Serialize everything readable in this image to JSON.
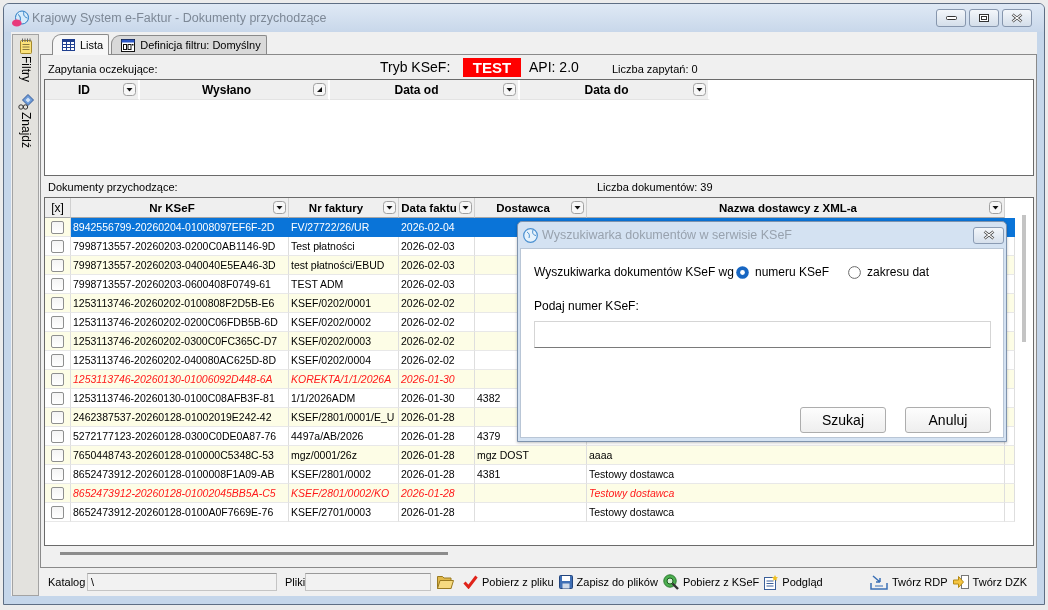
{
  "window": {
    "title": "Krajowy System e-Faktur - Dokumenty przychodzące",
    "active": false
  },
  "sidebar": {
    "items": [
      {
        "label": "Filtry"
      },
      {
        "label": "Znajdź"
      }
    ]
  },
  "tabs": [
    {
      "label": "Lista",
      "selected": true
    },
    {
      "label": "Definicja filtru: Domyślny",
      "selected": false
    }
  ],
  "pending_requests": {
    "label": "Zapytania oczekujące:",
    "mode_label": "Tryb KSeF:",
    "mode": "TEST",
    "api": "API: 2.0",
    "count": "Liczba zapytań: 0",
    "columns": [
      {
        "label": "ID",
        "kind": "dropdown"
      },
      {
        "label": "Wysłano",
        "kind": "corner"
      },
      {
        "label": "Data od",
        "kind": "dropdown"
      },
      {
        "label": "Data do",
        "kind": "dropdown"
      }
    ]
  },
  "documents": {
    "label": "Dokumenty przychodzące:",
    "count": "Liczba dokumentów: 39",
    "columns": [
      {
        "label": "[x]",
        "kind": "plain"
      },
      {
        "label": "Nr KSeF",
        "kind": "dropdown"
      },
      {
        "label": "Nr faktury",
        "kind": "dropdown"
      },
      {
        "label": "Data faktu",
        "kind": "dropdown"
      },
      {
        "label": "Dostawca",
        "kind": "dropdown"
      },
      {
        "label": "Nazwa dostawcy z XML-a",
        "kind": "dropdown"
      }
    ],
    "rows": [
      {
        "checked": false,
        "selected": true,
        "alert": false,
        "ksef_number": "8942556799-20260204-01008097EF6F-2D",
        "invoice_number": "FV/27722/26/UR",
        "invoice_date": "2026-02-04"
      },
      {
        "checked": false,
        "selected": false,
        "alert": false,
        "ksef_number": "7998713557-20260203-0200C0AB1146-9D",
        "invoice_number": "Test płatności",
        "invoice_date": "2026-02-03"
      },
      {
        "checked": false,
        "selected": false,
        "alert": false,
        "ksef_number": "7998713557-20260203-040040E5EA46-3D",
        "invoice_number": "test płatności/EBUD",
        "invoice_date": "2026-02-03"
      },
      {
        "checked": false,
        "selected": false,
        "alert": false,
        "ksef_number": "7998713557-20260203-0600408F0749-61",
        "invoice_number": "TEST ADM",
        "invoice_date": "2026-02-03"
      },
      {
        "checked": false,
        "selected": false,
        "alert": false,
        "ksef_number": "1253113746-20260202-0100808F2D5B-E6",
        "invoice_number": "KSEF/0202/0001",
        "invoice_date": "2026-02-02"
      },
      {
        "checked": false,
        "selected": false,
        "alert": false,
        "ksef_number": "1253113746-20260202-0200C06FDB5B-6D",
        "invoice_number": "KSEF/0202/0002",
        "invoice_date": "2026-02-02"
      },
      {
        "checked": false,
        "selected": false,
        "alert": false,
        "ksef_number": "1253113746-20260202-0300C0FC365C-D7",
        "invoice_number": "KSEF/0202/0003",
        "invoice_date": "2026-02-02"
      },
      {
        "checked": false,
        "selected": false,
        "alert": false,
        "ksef_number": "1253113746-20260202-040080AC625D-8D",
        "invoice_number": "KSEF/0202/0004",
        "invoice_date": "2026-02-02"
      },
      {
        "checked": false,
        "selected": false,
        "alert": true,
        "ksef_number": "1253113746-20260130-01006092D448-6A",
        "invoice_number": "KOREKTA/1/1/2026A",
        "invoice_date": "2026-01-30"
      },
      {
        "checked": false,
        "selected": false,
        "alert": false,
        "ksef_number": "1253113746-20260130-0100C08AFB3F-81",
        "invoice_number": "1/1/2026ADM",
        "invoice_date": "2026-01-30",
        "supplier": "4382"
      },
      {
        "checked": false,
        "selected": false,
        "alert": false,
        "ksef_number": "2462387537-20260128-01002019E242-42",
        "invoice_number": "KSEF/2801/0001/E_U",
        "invoice_date": "2026-01-28"
      },
      {
        "checked": false,
        "selected": false,
        "alert": false,
        "ksef_number": "5272177123-20260128-0300C0DE0A87-76",
        "invoice_number": "4497a/AB/2026",
        "invoice_date": "2026-01-28",
        "supplier": "4379"
      },
      {
        "checked": false,
        "selected": false,
        "alert": false,
        "ksef_number": "7650448743-20260128-010000C5348C-53",
        "invoice_number": "mgz/0001/26z",
        "invoice_date": "2026-01-28",
        "supplier": "mgz DOST",
        "supplier_xml_name": "aaaa"
      },
      {
        "checked": false,
        "selected": false,
        "alert": false,
        "ksef_number": "8652473912-20260128-0100008F1A09-AB",
        "invoice_number": "KSEF/2801/0002",
        "invoice_date": "2026-01-28",
        "supplier": "4381",
        "supplier_xml_name": "Testowy dostawca"
      },
      {
        "checked": false,
        "selected": false,
        "alert": true,
        "ksef_number": "8652473912-20260128-01002045BB5A-C5",
        "invoice_number": "KSEF/2801/0002/KO",
        "invoice_date": "2026-01-28",
        "supplier_xml_name": "Testowy dostawca"
      },
      {
        "checked": false,
        "selected": false,
        "alert": false,
        "ksef_number": "8652473912-20260128-0100A0F7669E-76",
        "invoice_number": "KSEF/2701/0003",
        "invoice_date": "2026-01-28",
        "supplier_xml_name": "Testowy dostawca"
      }
    ]
  },
  "dialog": {
    "title": "Wyszukiwarka dokumentów w serwisie KSeF",
    "active": false,
    "search_by": "Wyszukiwarka dokumentów KSeF wg",
    "options": [
      {
        "label": "numeru KSeF",
        "selected": true
      },
      {
        "label": "zakresu dat",
        "selected": false
      }
    ],
    "field_label": "Podaj numer KSeF:",
    "buttons": [
      "Szukaj",
      "Anuluj"
    ]
  },
  "bottom_bar": {
    "catalog": {
      "label": "Katalog",
      "value": "\\"
    },
    "files": {
      "label": "Pliki"
    },
    "actions": [
      "Pobierz z pliku",
      "Zapisz do plików",
      "Pobierz z KSeF",
      "Podgląd"
    ],
    "right_actions": [
      "Twórz RDP",
      "Twórz DZK"
    ]
  }
}
